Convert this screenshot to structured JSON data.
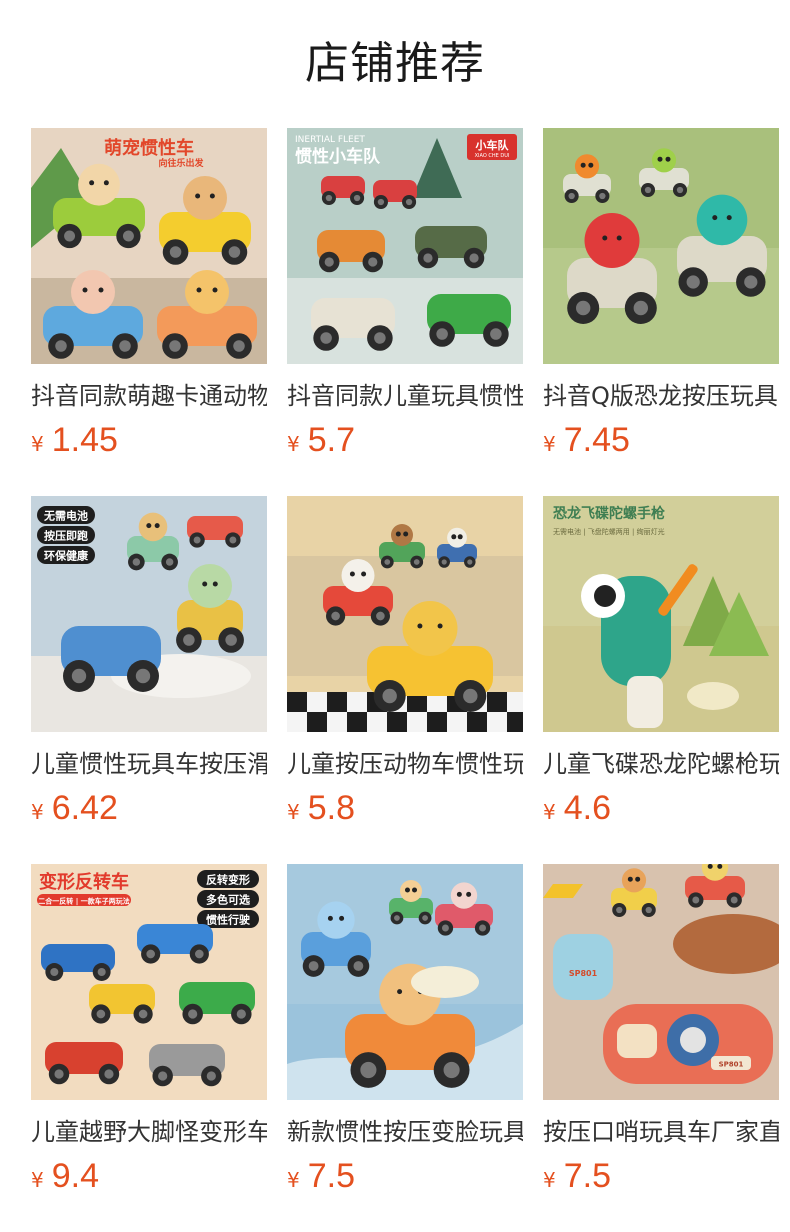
{
  "title": "店铺推荐",
  "currency_symbol": "¥",
  "products": [
    {
      "name": "抖音同款萌趣卡通动物惯性车",
      "price": "1.45",
      "image_text": [
        "萌宠惯性车",
        "向往乐出发"
      ],
      "theme": "animals",
      "bg": "#e7d5c2"
    },
    {
      "name": "抖音同款儿童玩具惯性小车队",
      "price": "5.7",
      "image_text": [
        "INERTIAL FLEET",
        "惯性小车队",
        "小车队",
        "XIAO CHE DUI"
      ],
      "theme": "trucks",
      "bg": "#b9cfc8"
    },
    {
      "name": "抖音Q版恐龙按压玩具车",
      "price": "7.45",
      "image_text": [],
      "theme": "dinos",
      "bg": "#a9c07c"
    },
    {
      "name": "儿童惯性玩具车按压滑行小车",
      "price": "6.42",
      "image_text": [
        "无需电池",
        "按压即跑",
        "环保健康"
      ],
      "theme": "train",
      "bg": "#c4d3dd"
    },
    {
      "name": "儿童按压动物车惯性玩具",
      "price": "5.8",
      "image_text": [],
      "theme": "cows",
      "bg": "#e8d3a6"
    },
    {
      "name": "儿童飞碟恐龙陀螺枪玩具",
      "price": "4.6",
      "image_text": [
        "恐龙飞碟陀螺手枪",
        "无需电池 | 飞盘陀螺两用 | 绚丽灯光"
      ],
      "theme": "gun",
      "bg": "#d2cf9a"
    },
    {
      "name": "儿童越野大脚怪变形车",
      "price": "9.4",
      "image_text": [
        "变形反转车",
        "二合一反转 | 一款车子两玩法",
        "反转变形",
        "多色可选",
        "惯性行驶"
      ],
      "theme": "monster",
      "bg": "#f2d9bb"
    },
    {
      "name": "新款惯性按压变脸玩具车",
      "price": "7.5",
      "image_text": [],
      "theme": "faces",
      "bg": "#a6c9de"
    },
    {
      "name": "按压口哨玩具车厂家直销",
      "price": "7.5",
      "image_text": [
        "SP801",
        "SP801"
      ],
      "theme": "whistle",
      "bg": "#d9c1ad"
    }
  ],
  "colors": {
    "price": "#e4501f",
    "title": "#1a1a1a",
    "name": "#333333"
  }
}
